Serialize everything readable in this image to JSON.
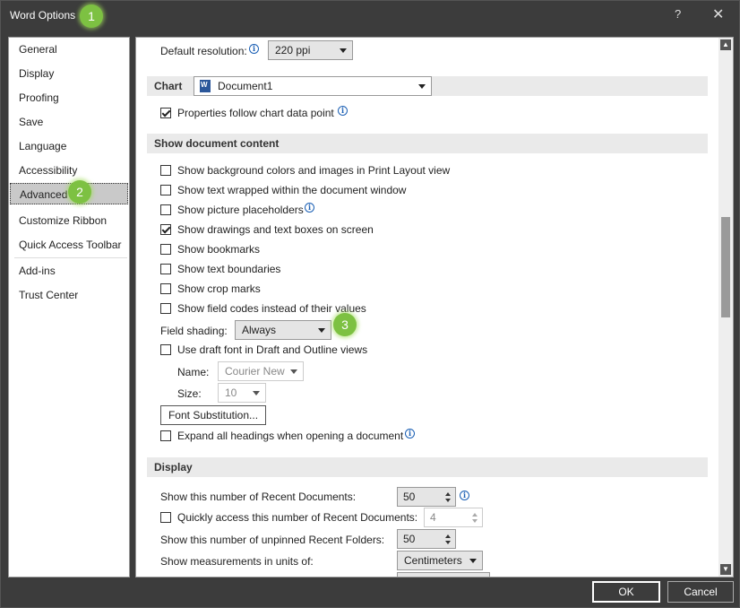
{
  "window": {
    "title": "Word Options",
    "help": "?",
    "close": "✕"
  },
  "badges": [
    "1",
    "2",
    "3"
  ],
  "sidebar": {
    "items": [
      {
        "label": "General"
      },
      {
        "label": "Display"
      },
      {
        "label": "Proofing"
      },
      {
        "label": "Save"
      },
      {
        "label": "Language"
      },
      {
        "label": "Accessibility"
      },
      {
        "label": "Advanced"
      },
      {
        "label": "Customize Ribbon"
      },
      {
        "label": "Quick Access Toolbar"
      },
      {
        "label": "Add-ins"
      },
      {
        "label": "Trust Center"
      }
    ],
    "selected": "Advanced"
  },
  "content": {
    "default_resolution": {
      "label": "Default resolution:",
      "value": "220 ppi"
    },
    "chart": {
      "header": "Chart",
      "document": "Document1",
      "properties_follow": {
        "label": "Properties follow chart data point",
        "checked": true
      }
    },
    "show_document_content": {
      "header": "Show document content",
      "options": [
        {
          "label": "Show background colors and images in Print Layout view",
          "checked": false
        },
        {
          "label": "Show text wrapped within the document window",
          "checked": false
        },
        {
          "label": "Show picture placeholders",
          "checked": false
        },
        {
          "label": "Show drawings and text boxes on screen",
          "checked": true
        },
        {
          "label": "Show bookmarks",
          "checked": false
        },
        {
          "label": "Show text boundaries",
          "checked": false
        },
        {
          "label": "Show crop marks",
          "checked": false
        },
        {
          "label": "Show field codes instead of their values",
          "checked": false
        }
      ],
      "field_shading": {
        "label": "Field shading:",
        "value": "Always"
      },
      "draft_font": {
        "label": "Use draft font in Draft and Outline views",
        "checked": false
      },
      "name": {
        "label": "Name:",
        "value": "Courier New"
      },
      "size": {
        "label": "Size:",
        "value": "10"
      },
      "font_substitution": "Font Substitution...",
      "expand_headings": {
        "label": "Expand all headings when opening a document",
        "checked": false
      }
    },
    "display": {
      "header": "Display",
      "recent_documents": {
        "label": "Show this number of Recent Documents:",
        "value": "50"
      },
      "quick_access": {
        "label": "Quickly access this number of Recent Documents:",
        "value": "4",
        "checked": false
      },
      "recent_folders": {
        "label": "Show this number of unpinned Recent Folders:",
        "value": "50"
      },
      "measurements": {
        "label": "Show measurements in units of:",
        "value": "Centimeters"
      }
    }
  },
  "footer": {
    "ok": "OK",
    "cancel": "Cancel"
  },
  "colors": {
    "badge": "#7dc142",
    "titlebar": "#3c3c3c",
    "selected_nav": "#c9c9c9",
    "info": "#1a5fb4"
  }
}
